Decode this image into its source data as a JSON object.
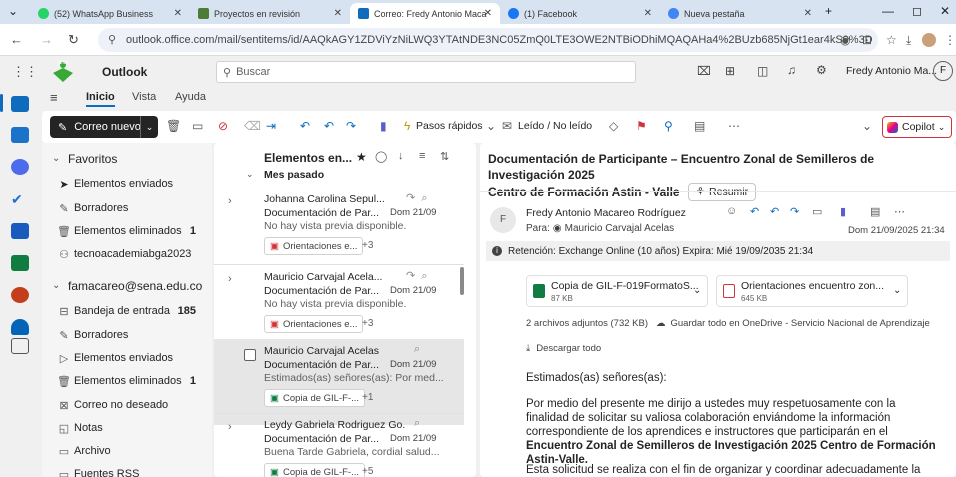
{
  "browser": {
    "tabs": [
      {
        "label": "(52) WhatsApp Business",
        "icon": "whatsapp-icon",
        "color": "#25d366"
      },
      {
        "label": "Proyectos en revisión",
        "icon": "sena-icon",
        "color": "#4e7b35"
      },
      {
        "label": "Correo: Fredy Antonio Maca",
        "icon": "outlook-icon",
        "color": "#0f6cbd"
      },
      {
        "label": "(1) Facebook",
        "icon": "facebook-icon",
        "color": "#1877f2"
      },
      {
        "label": "Nueva pestaña",
        "icon": "chrome-icon",
        "color": "#4285f4"
      }
    ],
    "url": "outlook.office.com/mail/sentitems/id/AAQkAGY1ZDViYzNiLWQ3YTAtNDE3NC05ZmQ0LTE3OWE2NTBiODhiMQAQAHa4%2BUzb685NjGt1ear4kS0%3D"
  },
  "outlook": {
    "app_name": "Outlook",
    "search_placeholder": "Buscar",
    "user_name": "Fredy Antonio Ma...",
    "user_initial": "F",
    "ribbon_tabs": [
      "Inicio",
      "Vista",
      "Ayuda"
    ],
    "toolbar": {
      "new_mail": "Correo nuevo",
      "quick_steps": "Pasos rápidos",
      "read_unread": "Leído / No leído",
      "copilot": "Copilot"
    }
  },
  "folders": {
    "favorites_header": "Favoritos",
    "favorites": [
      {
        "label": "Elementos enviados",
        "count": "",
        "icon": "send-icon",
        "selected": true
      },
      {
        "label": "Borradores",
        "count": "",
        "icon": "pencil-icon"
      },
      {
        "label": "Elementos eliminados",
        "count": "1",
        "icon": "trash-icon"
      },
      {
        "label": "tecnoacademiabga2023",
        "count": "",
        "icon": "group-icon"
      }
    ],
    "account_header": "famacareo@sena.edu.co",
    "account": [
      {
        "label": "Bandeja de entrada",
        "count": "185",
        "icon": "inbox-icon"
      },
      {
        "label": "Borradores",
        "count": "",
        "icon": "pencil-icon"
      },
      {
        "label": "Elementos enviados",
        "count": "",
        "icon": "send-icon"
      },
      {
        "label": "Elementos eliminados",
        "count": "1",
        "icon": "trash-icon"
      },
      {
        "label": "Correo no deseado",
        "count": "",
        "icon": "junk-icon"
      },
      {
        "label": "Notas",
        "count": "",
        "icon": "note-icon"
      },
      {
        "label": "Archivo",
        "count": "",
        "icon": "archive-icon"
      },
      {
        "label": "Fuentes RSS",
        "count": "",
        "icon": "rss-icon"
      }
    ]
  },
  "message_list": {
    "title": "Elementos en...",
    "group_header": "Mes pasado",
    "messages": [
      {
        "from": "Johanna Carolina Sepul...",
        "subject": "Documentación de Par...",
        "date": "Dom 21/09",
        "preview": "No hay vista previa disponible.",
        "attachment": "Orientaciones e...",
        "more": "+3"
      },
      {
        "from": "Mauricio Carvajal Acela...",
        "subject": "Documentación de Par...",
        "date": "Dom 21/09",
        "preview": "No hay vista previa disponible.",
        "attachment": "Orientaciones e...",
        "more": "+3"
      },
      {
        "from": "Mauricio Carvajal Acelas",
        "subject": "Documentación de Par...",
        "date": "Dom 21/09",
        "preview": "Estimados(as) señores(as): Por med...",
        "attachment": "Copia de GIL-F-...",
        "more": "+1"
      },
      {
        "from": "Leydy Gabriela Rodriguez Go...",
        "subject": "Documentación de Par...",
        "date": "Dom 21/09",
        "preview": "Buena Tarde Gabriela, cordial salud...",
        "attachment": "Copia de GIL-F-...",
        "more": "+5"
      }
    ]
  },
  "reading": {
    "subject_line1": "Documentación de Participante – Encuentro Zonal de Semilleros de Investigación 2025",
    "subject_line2": "Centro de Formación Astin - Valle",
    "summarize": "Resumir",
    "sender": "Fredy Antonio Macareo Rodríguez",
    "to_label": "Para:",
    "to_name": "Mauricio Carvajal Acelas",
    "date": "Dom 21/09/2025 21:34",
    "retention": "Retención: Exchange Online (10 años) Expira: Mié 19/09/2035 21:34",
    "attachments": [
      {
        "name": "Copia de GIL-F-019FormatoS...",
        "size": "87 KB",
        "type": "excel"
      },
      {
        "name": "Orientaciones encuentro zon...",
        "size": "645 KB",
        "type": "pdf"
      }
    ],
    "attachments_summary": "2 archivos adjuntos (732 KB)",
    "save_onedrive": "Guardar todo en OneDrive - Servicio Nacional de Aprendizaje",
    "download_all": "Descargar todo",
    "greeting": "Estimados(as) señores(as):",
    "para1_a": "Por medio del presente me dirijo a ustedes muy respetuosamente con la finalidad de solicitar su valiosa colaboración enviándome la información correspondiente de los aprendices e instructores que participarán en el ",
    "para1_b": "Encuentro Zonal de Semilleros de Investigación 2025 Centro de Formación Astin-Valle.",
    "para2": "Esta solicitud se realiza con el fin de organizar y coordinar adecuadamente la"
  }
}
